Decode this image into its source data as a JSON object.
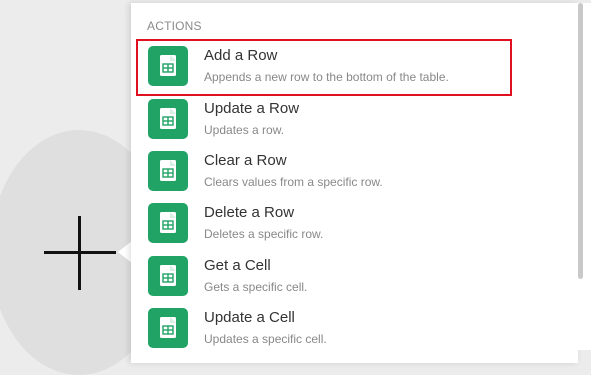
{
  "section": {
    "label": "ACTIONS"
  },
  "actions": [
    {
      "title": "Add a Row",
      "description": "Appends a new row to the bottom of the table.",
      "selected": true
    },
    {
      "title": "Update a Row",
      "description": "Updates a row.",
      "selected": false
    },
    {
      "title": "Clear a Row",
      "description": "Clears values from a specific row.",
      "selected": false
    },
    {
      "title": "Delete a Row",
      "description": "Deletes a specific row.",
      "selected": false
    },
    {
      "title": "Get a Cell",
      "description": "Gets a specific cell.",
      "selected": false
    },
    {
      "title": "Update a Cell",
      "description": "Updates a specific cell.",
      "selected": false
    }
  ],
  "icons": {
    "app": "google-sheets-icon",
    "add": "plus-icon"
  },
  "colors": {
    "sheets_green": "#21a366",
    "selection_outline": "#e01020"
  }
}
